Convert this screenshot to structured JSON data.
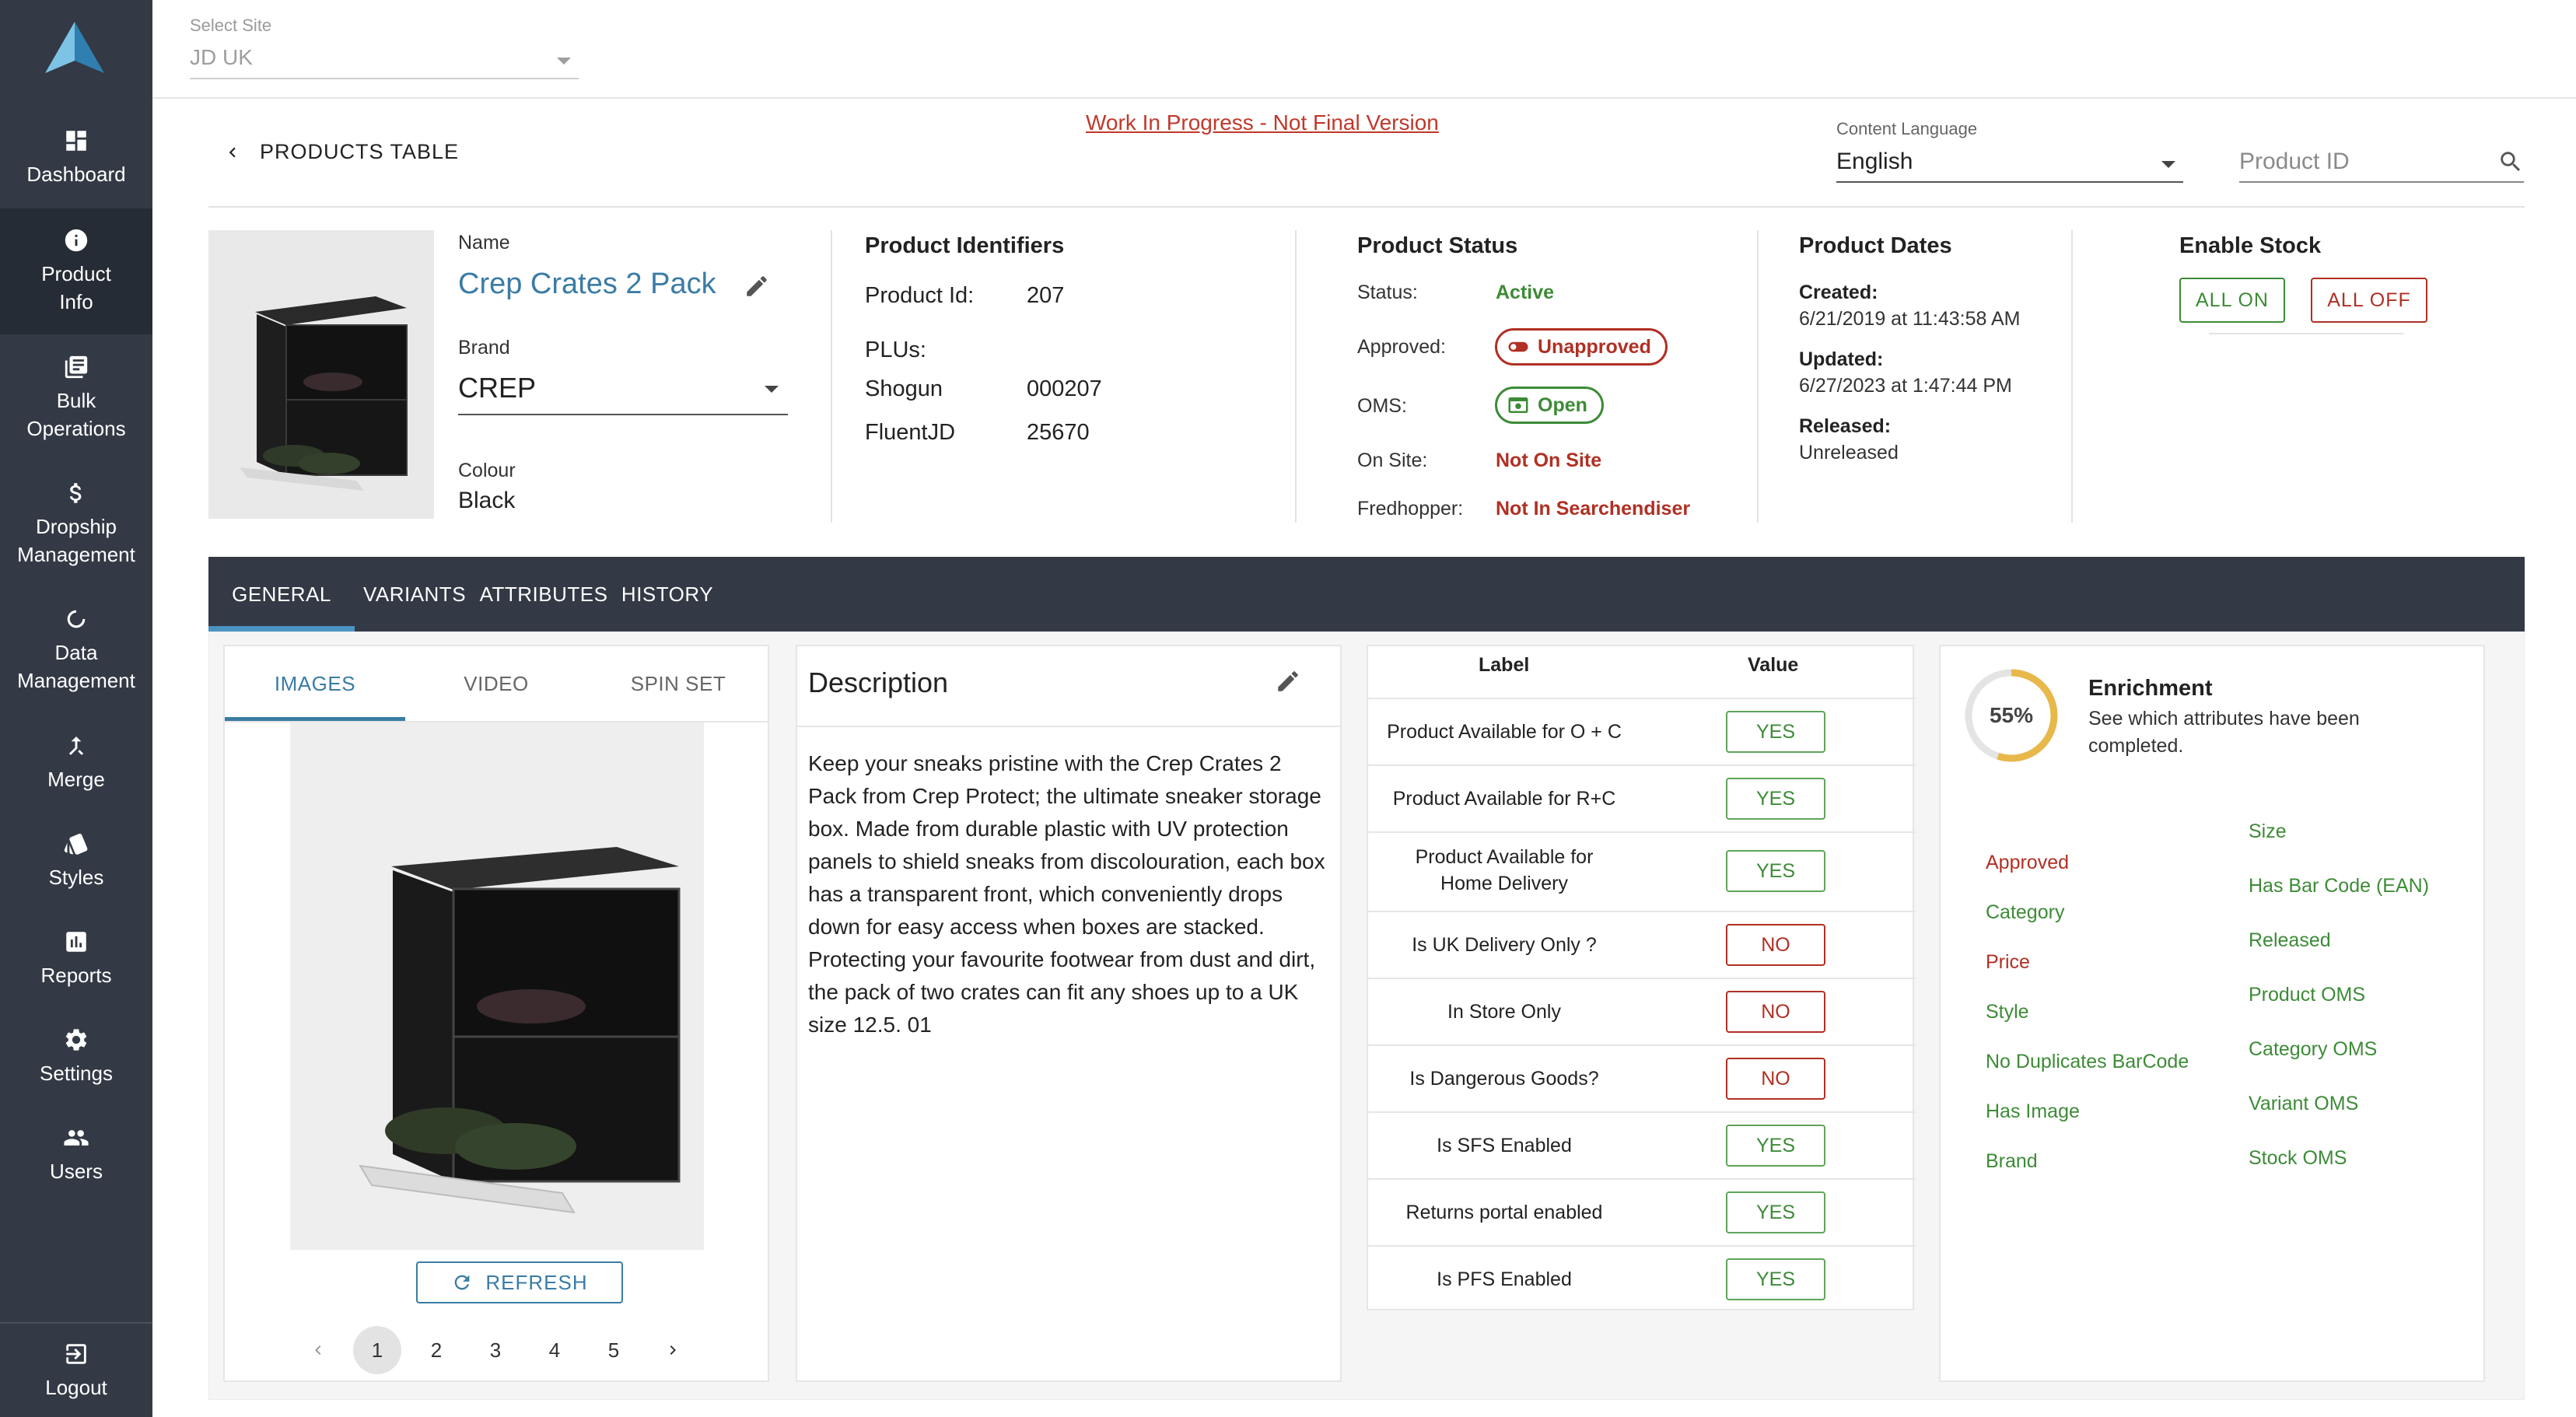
{
  "sidebar": {
    "items": [
      {
        "label": "Dashboard",
        "icon": "dashboard-icon",
        "active": false
      },
      {
        "label": "Product Info",
        "icon": "info-icon",
        "active": true
      },
      {
        "label": "Bulk Operations",
        "icon": "document-icon",
        "active": false
      },
      {
        "label": "Dropship Management",
        "icon": "dollar-icon",
        "active": false
      },
      {
        "label": "Data Management",
        "icon": "refresh-circle-icon",
        "active": false
      },
      {
        "label": "Merge",
        "icon": "merge-icon",
        "active": false
      },
      {
        "label": "Styles",
        "icon": "styles-icon",
        "active": false
      },
      {
        "label": "Reports",
        "icon": "reports-icon",
        "active": false
      },
      {
        "label": "Settings",
        "icon": "gear-icon",
        "active": false
      },
      {
        "label": "Users",
        "icon": "users-icon",
        "active": false
      }
    ],
    "logout_label": "Logout"
  },
  "topbar": {
    "site_caption": "Select Site",
    "site_value": "JD UK"
  },
  "header": {
    "back_label": "PRODUCTS TABLE",
    "wip_text": "Work In Progress - Not Final Version",
    "language_caption": "Content Language",
    "language_value": "English",
    "product_id_placeholder": "Product ID"
  },
  "product": {
    "name_label": "Name",
    "name": "Crep Crates 2 Pack",
    "brand_label": "Brand",
    "brand": "CREP",
    "colour_label": "Colour",
    "colour": "Black"
  },
  "identifiers": {
    "title": "Product Identifiers",
    "product_id_label": "Product Id:",
    "product_id": "207",
    "plus_label": "PLUs:",
    "rows": [
      {
        "label": "Shogun",
        "value": "000207"
      },
      {
        "label": "FluentJD",
        "value": "25670"
      }
    ]
  },
  "status": {
    "title": "Product Status",
    "status_label": "Status:",
    "status_value": "Active",
    "approved_label": "Approved:",
    "approved_value": "Unapproved",
    "oms_label": "OMS:",
    "oms_value": "Open",
    "onsite_label": "On Site:",
    "onsite_value": "Not On Site",
    "fredhopper_label": "Fredhopper:",
    "fredhopper_value": "Not In Searchendiser"
  },
  "dates": {
    "title": "Product Dates",
    "created_label": "Created:",
    "created_value": "6/21/2019 at 11:43:58 AM",
    "updated_label": "Updated:",
    "updated_value": "6/27/2023 at 1:47:44 PM",
    "released_label": "Released:",
    "released_value": "Unreleased"
  },
  "stock": {
    "title": "Enable Stock",
    "all_on": "ALL ON",
    "all_off": "ALL OFF"
  },
  "tabs": [
    "GENERAL",
    "VARIANTS",
    "ATTRIBUTES",
    "HISTORY"
  ],
  "media": {
    "tabs": [
      "IMAGES",
      "VIDEO",
      "SPIN SET"
    ],
    "refresh_label": "REFRESH",
    "pages": [
      "1",
      "2",
      "3",
      "4",
      "5"
    ],
    "current_page": "1"
  },
  "description": {
    "title": "Description",
    "text": "Keep your sneaks pristine with the Crep Crates 2 Pack from Crep Protect; the ultimate sneaker storage box. Made from durable plastic with UV protection panels to shield sneaks from discolouration, each box has a transparent front, which conveniently drops down for easy access when boxes are stacked. Protecting your favourite footwear from dust and dirt, the pack of two crates can fit any shoes up to a UK size 12.5. 01"
  },
  "flags": {
    "label_header": "Label",
    "value_header": "Value",
    "rows": [
      {
        "label": "Product Available for O + C",
        "value": "YES"
      },
      {
        "label": "Product Available for R+C",
        "value": "YES"
      },
      {
        "label": "Product Available for Home Delivery",
        "value": "YES"
      },
      {
        "label": "Is UK Delivery Only ?",
        "value": "NO"
      },
      {
        "label": "In Store Only",
        "value": "NO"
      },
      {
        "label": "Is Dangerous Goods?",
        "value": "NO"
      },
      {
        "label": "Is SFS Enabled",
        "value": "YES"
      },
      {
        "label": "Returns portal enabled",
        "value": "YES"
      },
      {
        "label": "Is PFS Enabled",
        "value": "YES"
      }
    ]
  },
  "enrichment": {
    "percent": "55%",
    "percent_value": 55,
    "title": "Enrichment",
    "subtitle": "See which attributes have been completed.",
    "left": [
      {
        "label": "Approved",
        "done": false
      },
      {
        "label": "Category",
        "done": true
      },
      {
        "label": "Price",
        "done": false
      },
      {
        "label": "Style",
        "done": true
      },
      {
        "label": "No Duplicates BarCode",
        "done": true
      },
      {
        "label": "Has Image",
        "done": true
      },
      {
        "label": "Brand",
        "done": true
      }
    ],
    "right": [
      {
        "label": "Size",
        "done": true
      },
      {
        "label": "Has Bar Code (EAN)",
        "done": true
      },
      {
        "label": "Released",
        "done": true
      },
      {
        "label": "Product OMS",
        "done": true
      },
      {
        "label": "Category OMS",
        "done": true
      },
      {
        "label": "Variant OMS",
        "done": true
      },
      {
        "label": "Stock OMS",
        "done": true
      }
    ],
    "colors": {
      "done": "#3d8b37",
      "missing": "#b03024",
      "ring": "#e8b84b"
    }
  }
}
